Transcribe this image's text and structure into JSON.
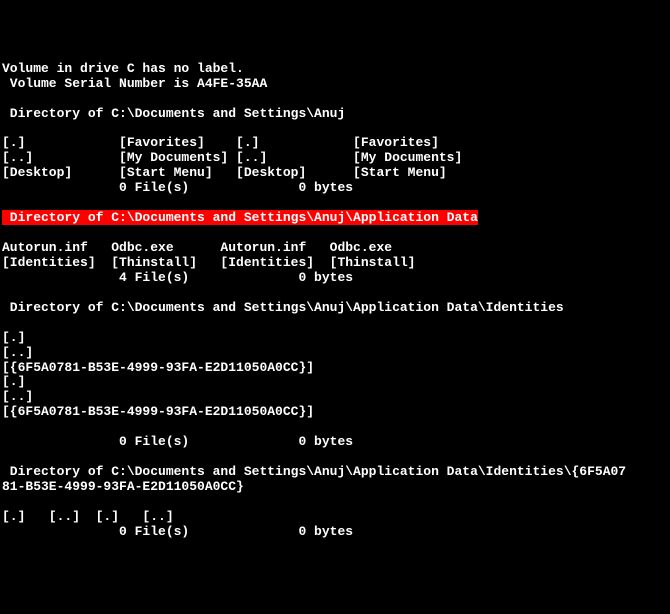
{
  "lines": [
    {
      "text": "Volume in drive C has no label.",
      "highlight": false
    },
    {
      "text": " Volume Serial Number is A4FE-35AA",
      "highlight": false
    },
    {
      "text": "",
      "highlight": false
    },
    {
      "text": " Directory of C:\\Documents and Settings\\Anuj",
      "highlight": false
    },
    {
      "text": "",
      "highlight": false
    },
    {
      "text": "[.]            [Favorites]    [.]            [Favorites]",
      "highlight": false
    },
    {
      "text": "[..]           [My Documents] [..]           [My Documents]",
      "highlight": false
    },
    {
      "text": "[Desktop]      [Start Menu]   [Desktop]      [Start Menu]",
      "highlight": false
    },
    {
      "text": "               0 File(s)              0 bytes",
      "highlight": false
    },
    {
      "text": "",
      "highlight": false
    },
    {
      "text": " Directory of C:\\Documents and Settings\\Anuj\\Application Data",
      "highlight": true
    },
    {
      "text": "",
      "highlight": false
    },
    {
      "text": "Autorun.inf   Odbc.exe      Autorun.inf   Odbc.exe",
      "highlight": false
    },
    {
      "text": "[Identities]  [Thinstall]   [Identities]  [Thinstall]",
      "highlight": false
    },
    {
      "text": "               4 File(s)              0 bytes",
      "highlight": false
    },
    {
      "text": "",
      "highlight": false
    },
    {
      "text": " Directory of C:\\Documents and Settings\\Anuj\\Application Data\\Identities",
      "highlight": false
    },
    {
      "text": "",
      "highlight": false
    },
    {
      "text": "[.]",
      "highlight": false
    },
    {
      "text": "[..]",
      "highlight": false
    },
    {
      "text": "[{6F5A0781-B53E-4999-93FA-E2D11050A0CC}]",
      "highlight": false
    },
    {
      "text": "[.]",
      "highlight": false
    },
    {
      "text": "[..]",
      "highlight": false
    },
    {
      "text": "[{6F5A0781-B53E-4999-93FA-E2D11050A0CC}]",
      "highlight": false
    },
    {
      "text": "",
      "highlight": false
    },
    {
      "text": "               0 File(s)              0 bytes",
      "highlight": false
    },
    {
      "text": "",
      "highlight": false
    },
    {
      "text": " Directory of C:\\Documents and Settings\\Anuj\\Application Data\\Identities\\{6F5A07",
      "highlight": false
    },
    {
      "text": "81-B53E-4999-93FA-E2D11050A0CC}",
      "highlight": false
    },
    {
      "text": "",
      "highlight": false
    },
    {
      "text": "[.]   [..]  [.]   [..]",
      "highlight": false
    },
    {
      "text": "               0 File(s)              0 bytes",
      "highlight": false
    }
  ]
}
